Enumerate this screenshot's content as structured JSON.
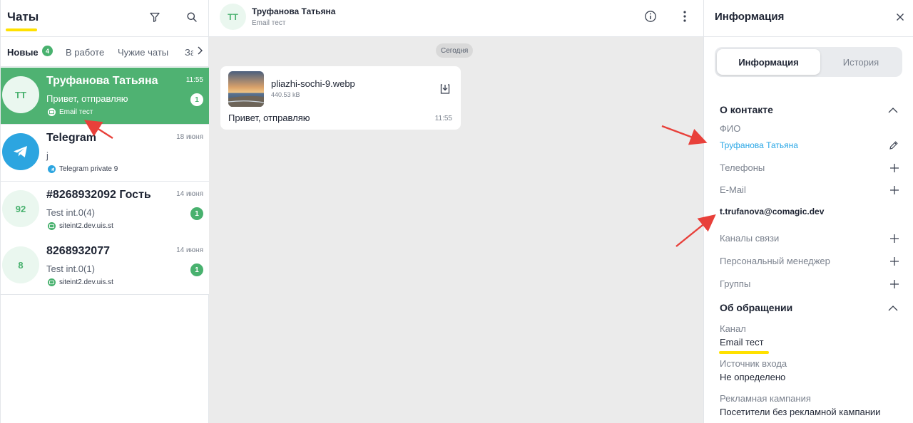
{
  "left": {
    "title": "Чаты",
    "tabs": [
      {
        "label": "Новые",
        "badge": "4"
      },
      {
        "label": "В работе"
      },
      {
        "label": "Чужие чаты"
      },
      {
        "label": "За"
      }
    ],
    "chats": [
      {
        "avatar": "TT",
        "name": "Труфанова Татьяна",
        "time": "11:55",
        "message": "Привет, отправляю",
        "source": "Email тест",
        "unread": "1"
      },
      {
        "avatar": "",
        "name": "Telegram",
        "time": "18 июня",
        "message": "j",
        "source": "Telegram private 9",
        "unread": ""
      },
      {
        "avatar": "92",
        "name": "#8268932092 Гость",
        "time": "14 июня",
        "message": "Test int.0(4)",
        "source": "siteint2.dev.uis.st",
        "unread": "1"
      },
      {
        "avatar": "8",
        "name": "8268932077",
        "time": "14 июня",
        "message": "Test int.0(1)",
        "source": "siteint2.dev.uis.st",
        "unread": "1"
      }
    ]
  },
  "middle": {
    "avatar": "TT",
    "contact_name": "Труфанова Татьяна",
    "channel": "Email тест",
    "date_chip": "Сегодня",
    "message": {
      "file_name": "pliazhi-sochi-9.webp",
      "file_size": "440.53 kB",
      "text": "Привет, отправляю",
      "time": "11:55"
    }
  },
  "right": {
    "title": "Информация",
    "segments": [
      "Информация",
      "История"
    ],
    "contact_section": "О контакте",
    "fio_label": "ФИО",
    "fio_value": "Труфанова Татьяна",
    "phones_label": "Телефоны",
    "email_label": "E-Mail",
    "email_value": "t.trufanova@comagic.dev",
    "channels_label": "Каналы связи",
    "manager_label": "Персональный менеджер",
    "groups_label": "Группы",
    "request_section": "Об обращении",
    "channel_label": "Канал",
    "channel_value": "Email тест",
    "source_label": "Источник входа",
    "source_value": "Не определено",
    "campaign_label": "Рекламная кампания",
    "campaign_value": "Посетители без рекламной кампании"
  },
  "colors": {
    "accent_green": "#4fb272",
    "badge_green": "#48b16e",
    "link_blue": "#2aa7e6",
    "highlight_yellow": "#ffe100",
    "annotation_red": "#e8403a"
  }
}
